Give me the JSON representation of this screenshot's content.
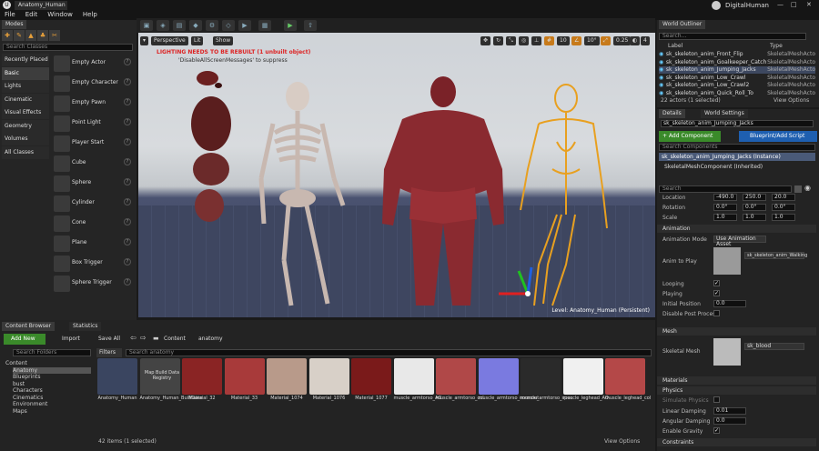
{
  "window": {
    "title": "Anatomy_Human",
    "project": "DigitalHuman"
  },
  "menu": [
    "File",
    "Edit",
    "Window",
    "Help"
  ],
  "modes": {
    "tab": "Modes",
    "search_placeholder": "Search Classes",
    "categories": [
      "Recently Placed",
      "Basic",
      "Lights",
      "Cinematic",
      "Visual Effects",
      "Geometry",
      "Volumes",
      "All Classes"
    ],
    "selected_category": "Basic",
    "items": [
      "Empty Actor",
      "Empty Character",
      "Empty Pawn",
      "Point Light",
      "Player Start",
      "Cube",
      "Sphere",
      "Cylinder",
      "Cone",
      "Plane",
      "Box Trigger",
      "Sphere Trigger"
    ]
  },
  "viewport": {
    "perspective": "Perspective",
    "lit": "Lit",
    "show": "Show",
    "warning": "LIGHTING NEEDS TO BE REBUILT (1 unbuilt object)",
    "warning2": "'DisableAllScreenMessages' to suppress",
    "level": "Level:  Anatomy_Human (Persistent)",
    "snap_grid": "10",
    "snap_rot": "10°",
    "snap_scale": "0.25",
    "cam_speed": "4"
  },
  "outliner": {
    "tab": "World Outliner",
    "search_placeholder": "Search...",
    "col_label": "Label",
    "col_type": "Type",
    "rows": [
      {
        "label": "sk_skeleton_anim_Front_Flip",
        "type": "SkeletalMeshActo",
        "sel": false
      },
      {
        "label": "sk_skeleton_anim_Goalkeeper_Catch",
        "type": "SkeletalMeshActo",
        "sel": false
      },
      {
        "label": "sk_skeleton_anim_Jumping_Jacks",
        "type": "SkeletalMeshActo",
        "sel": true
      },
      {
        "label": "sk_skeleton_anim_Low_Crawl",
        "type": "SkeletalMeshActo",
        "sel": false
      },
      {
        "label": "sk_skeleton_anim_Low_Crawl2",
        "type": "SkeletalMeshActo",
        "sel": false
      },
      {
        "label": "sk_skeleton_anim_Quick_Roll_To",
        "type": "SkeletalMeshActo",
        "sel": false
      }
    ],
    "count": "22 actors (1 selected)",
    "view_options": "View Options"
  },
  "details": {
    "tab": "Details",
    "tab2": "World Settings",
    "actor_name": "sk_skeleton_anim_Jumping_Jacks",
    "add_component": "+ Add Component",
    "blueprint": "Blueprint/Add Script",
    "search_placeholder": "Search Components",
    "instance": "sk_skeleton_anim_Jumping_Jacks (Instance)",
    "component": "SkeletalMeshComponent (Inherited)",
    "search2": "Search",
    "location_label": "Location",
    "location": [
      "-490.0",
      "250.0",
      "20.0"
    ],
    "rotation_label": "Rotation",
    "rotation": [
      "0.0°",
      "0.0°",
      "0.0°"
    ],
    "scale_label": "Scale",
    "scale": [
      "1.0",
      "1.0",
      "1.0"
    ],
    "anim_section": "Animation",
    "anim_mode_label": "Animation Mode",
    "anim_mode": "Use Animation Asset",
    "anim_to_play_label": "Anim to Play",
    "anim_to_play": "sk_skeleton_anim_Walking",
    "looping_label": "Looping",
    "playing_label": "Playing",
    "initial_pos_label": "Initial Position",
    "initial_pos": "0.0",
    "disable_post_label": "Disable Post Process",
    "mesh_section": "Mesh",
    "skeletal_mesh_label": "Skeletal Mesh",
    "skeletal_mesh": "sk_blood",
    "materials_section": "Materials",
    "physics_section": "Physics",
    "simulate_label": "Simulate Physics",
    "linear_damp_label": "Linear Damping",
    "linear_damp": "0.01",
    "angular_damp_label": "Angular Damping",
    "angular_damp": "0.0",
    "gravity_label": "Enable Gravity",
    "constraints_section": "Constraints"
  },
  "content": {
    "tab": "Content Browser",
    "tab2": "Statistics",
    "add_new": "Add New",
    "import": "Import",
    "save_all": "Save All",
    "path_root": "Content",
    "path_folder": "anatomy",
    "filters": "Filters",
    "search_placeholder": "Search anatomy",
    "folder_search": "Search Folders",
    "folders": [
      "Content",
      "Anatomy",
      "Blueprints",
      "bust",
      "Characters",
      "Cinematics",
      "Environment",
      "Maps"
    ],
    "assets": [
      {
        "name": "Anatomy_Human",
        "color": "#3a4560"
      },
      {
        "name": "Anatomy_Human_BuiltData",
        "color": "#444"
      },
      {
        "name": "Material_32",
        "color": "#8a2424"
      },
      {
        "name": "Material_33",
        "color": "#a83a3a"
      },
      {
        "name": "Material_1074",
        "color": "#b89a8a"
      },
      {
        "name": "Material_1076",
        "color": "#d8d0c8"
      },
      {
        "name": "Material_1077",
        "color": "#7a1a1a"
      },
      {
        "name": "muscle_armtorso_AO",
        "color": "#e8e8e8"
      },
      {
        "name": "muscle_armtorso_col",
        "color": "#b04848"
      },
      {
        "name": "muscle_armtorso_normout",
        "color": "#7a7ae0"
      },
      {
        "name": "muscle_armtorso_spec",
        "color": "#2a2a2a"
      },
      {
        "name": "muscle_leghead_AO",
        "color": "#f0f0f0"
      },
      {
        "name": "muscle_leghead_col",
        "color": "#b44848"
      }
    ],
    "count": "42 items (1 selected)",
    "view_options": "View Options",
    "map_label": "Map Build Data Registry"
  }
}
